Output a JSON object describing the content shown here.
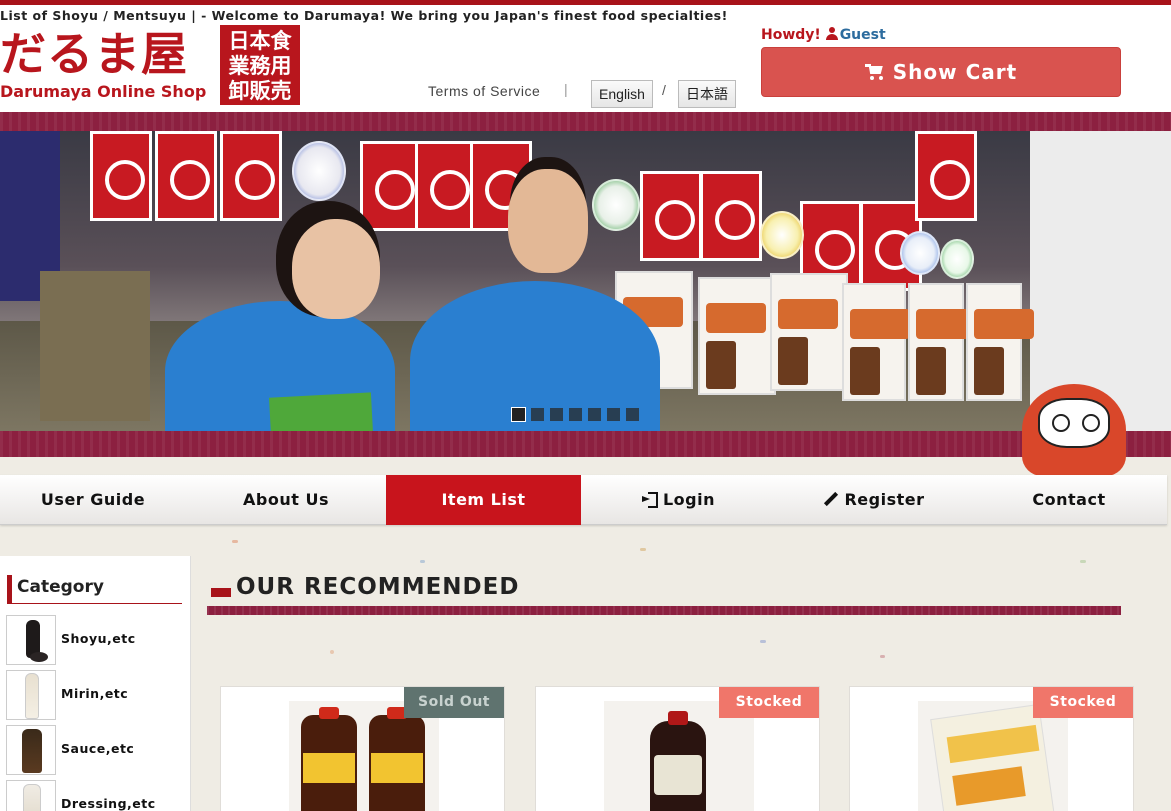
{
  "header": {
    "tagline": "List of Shoyu / Mentsuyu | - Welcome to Darumaya! We bring you Japan's finest food specialties!",
    "logo_jp": "だるま屋",
    "logo_en": "Darumaya Online Shop",
    "logo_box_lines": [
      "日本食",
      "業務用",
      "卸販売"
    ],
    "terms_link": "Terms of Service",
    "separator": "|",
    "lang_english": "English",
    "lang_slash": "/",
    "lang_japanese": "日本語",
    "howdy_label": "Howdy!",
    "user_name": "Guest",
    "cart_button": "Show Cart"
  },
  "banner": {
    "slides_count": 7,
    "active_slide": 1
  },
  "nav": {
    "items": [
      {
        "label": "User Guide",
        "active": false
      },
      {
        "label": "About Us",
        "active": false
      },
      {
        "label": "Item List",
        "active": true
      },
      {
        "label": "Login",
        "active": false,
        "icon": "login-icon"
      },
      {
        "label": "Register",
        "active": false,
        "icon": "pencil-icon"
      },
      {
        "label": "Contact",
        "active": false
      }
    ]
  },
  "sidebar": {
    "title": "Category",
    "categories": [
      {
        "label": "Shoyu,etc"
      },
      {
        "label": "Mirin,etc"
      },
      {
        "label": "Sauce,etc"
      },
      {
        "label": "Dressing,etc"
      }
    ]
  },
  "main": {
    "section_title": "OUR RECOMMENDED",
    "products": [
      {
        "status": "Sold Out"
      },
      {
        "status": "Stocked"
      },
      {
        "status": "Stocked"
      }
    ]
  },
  "colors": {
    "brand_red": "#b8161d",
    "band_maroon": "#8c2040",
    "cart_button": "#d9534f",
    "nav_active": "#c8141c",
    "badge_sold_out": "#5f736f",
    "badge_stocked": "#f0766a",
    "guest_link": "#2d6c9e"
  }
}
